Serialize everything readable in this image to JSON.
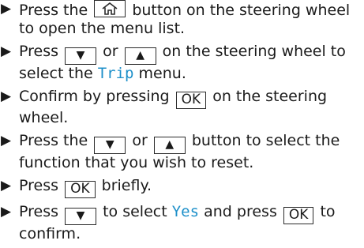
{
  "steps": [
    {
      "t1": "Press the",
      "t2": "button on the steering wheel",
      "t3": "to open the menu list."
    },
    {
      "t1": "Press",
      "t2": "or",
      "t3": "on the steering wheel to",
      "t4": "select the",
      "accent": "Trip",
      "t5": "menu."
    },
    {
      "t1": "Confirm by pressing",
      "key": "OK",
      "t2": "on the steering",
      "t3": "wheel."
    },
    {
      "t1": "Press the",
      "t2": "or",
      "t3": "button to select the",
      "t4": "function that you wish to reset."
    },
    {
      "t1": "Press",
      "key": "OK",
      "t2": "briefly."
    },
    {
      "t1": "Press",
      "t2": "to select",
      "accent": "Yes",
      "t3": "and press",
      "key": "OK",
      "t4": "to",
      "t5": "confirm."
    }
  ],
  "icons": {
    "bullet": "▶",
    "down": "▼",
    "up": "▲",
    "home": "home-icon"
  },
  "colors": {
    "accent": "#1c8fc9",
    "text": "#1a1a1a"
  }
}
